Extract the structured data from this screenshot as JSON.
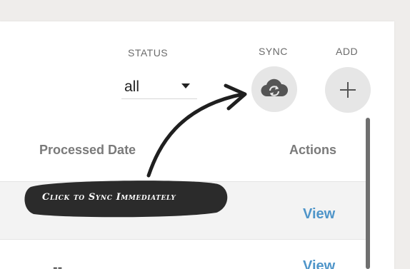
{
  "filters": {
    "status_label": "STATUS",
    "status_value": "all"
  },
  "actions": {
    "sync_label": "SYNC",
    "add_label": "ADD",
    "sync_icon": "cloud-sync-icon",
    "add_icon": "plus-icon"
  },
  "table": {
    "columns": [
      "Processed Date",
      "Actions"
    ],
    "rows": [
      {
        "processed_date": "",
        "action": "View"
      },
      {
        "processed_date": "--",
        "action": "View"
      }
    ]
  },
  "annotation": {
    "callout_text": "Click to Sync Immediately"
  },
  "colors": {
    "link": "#4f95c9",
    "callout_bg": "#2b2b2b",
    "button_bg": "#e6e6e6"
  }
}
